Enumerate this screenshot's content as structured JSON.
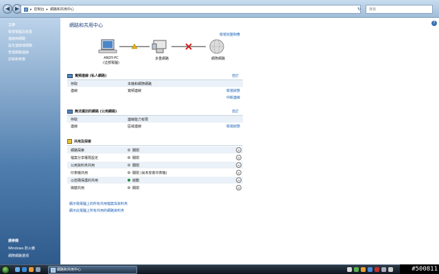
{
  "address": {
    "segments": [
      "控制台",
      "網路和共用中心"
    ],
    "search_placeholder": "搜尋"
  },
  "sidebar": {
    "tasks_heading": "工作",
    "tasks": [
      "檢視電腦及裝置",
      "連線到網路",
      "設定連線或網路",
      "管理網路連線",
      "診斷和修復"
    ],
    "see_also_heading": "請參閱",
    "see_also": [
      "Windows 防火牆",
      "網際網路選項"
    ]
  },
  "main": {
    "title": "網路和共用中心",
    "view_full_map": "檢視完整對應",
    "nodes": [
      {
        "label": "ANDY-PC",
        "sublabel": "(這部電腦)"
      },
      {
        "label": "多重網路",
        "sublabel": ""
      },
      {
        "label": "網際網路",
        "sublabel": ""
      }
    ],
    "networks": [
      {
        "name": "寬頻連線 (私人網路)",
        "customize": "自訂",
        "rows": [
          {
            "key": "存取",
            "value": "本機和網際網路",
            "link": ""
          },
          {
            "key": "連線",
            "value": "寬頻連線",
            "link": "檢視狀態"
          }
        ],
        "extra_link": "中斷連線"
      },
      {
        "name": "無法識別的網路 (公用網路)",
        "customize": "自訂",
        "rows": [
          {
            "key": "存取",
            "value": "連線能力有限",
            "link": ""
          },
          {
            "key": "連線",
            "value": "區域連線",
            "link": "檢視狀態"
          }
        ]
      }
    ],
    "sharing": {
      "heading": "共用及探索",
      "rows": [
        {
          "key": "網路探索",
          "value": "關閉",
          "on": false
        },
        {
          "key": "檔案分享權限設定",
          "value": "關閉",
          "on": false
        },
        {
          "key": "公用資料夾共用",
          "value": "關閉",
          "on": false
        },
        {
          "key": "印表機共用",
          "value": "關閉 (尚未安裝印表機)",
          "on": false
        },
        {
          "key": "以密碼保護的共用",
          "value": "啟動",
          "on": true
        },
        {
          "key": "媒體共用",
          "value": "關閉",
          "on": false
        }
      ]
    },
    "bottom_links": [
      "顯示我電腦上的所有共用檔案與資料夾",
      "顯示此電腦上所有共用的網路資料夾"
    ]
  },
  "taskbar": {
    "window_button": "網路和共用中心"
  },
  "watermark": "#500811",
  "colors": {
    "accent": "#1a5fb4",
    "sidebar_top": "#bcd3ea",
    "sidebar_bottom": "#2e5a8c",
    "row_shade": "#eaf1f8",
    "warning": "#e8b400",
    "error": "#d62020",
    "status_on": "#2ea84a"
  }
}
